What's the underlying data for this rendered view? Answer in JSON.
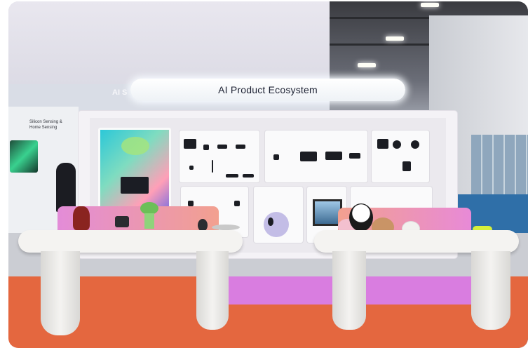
{
  "sign": {
    "title": "AI Product Ecosystem"
  },
  "side_label": "AI S",
  "left_booth_text": [
    "Silicon Sensing &",
    "Home Sensing"
  ]
}
